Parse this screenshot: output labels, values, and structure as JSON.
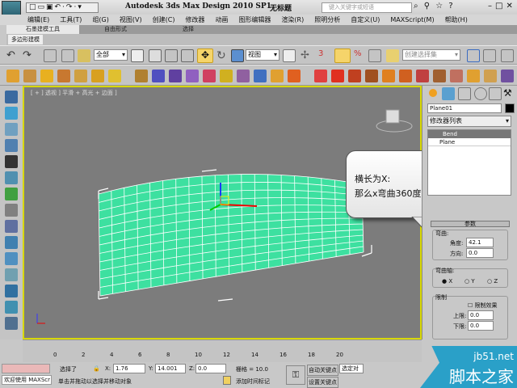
{
  "titlebar": {
    "app_title": "Autodesk 3ds Max Design 2010 SP1",
    "doc_title": "无标题",
    "search_placeholder": "键入关键字或短语",
    "logo": "3DS",
    "quick_access": "□▭▣↶·↷·▾"
  },
  "menu": [
    "编辑(E)",
    "工具(T)",
    "组(G)",
    "视图(V)",
    "创建(C)",
    "修改器",
    "动画",
    "图形编辑器",
    "渲染(R)",
    "照明分析",
    "自定义(U)",
    "MAXScript(M)",
    "帮助(H)"
  ],
  "ribbon_tabs": [
    "石墨建模工具",
    "自由形式",
    "选择"
  ],
  "subtab": "多边形建模",
  "toolbar": {
    "selection_filter": "全部",
    "ref_coord": "视图",
    "named_selection": "创建选择集"
  },
  "viewport": {
    "label": "[ + ] 透视 ] 平滑 + 高光 + 边面 ]"
  },
  "callout": {
    "line1": "横长为X:",
    "line2": "那么x弯曲360度"
  },
  "panel": {
    "object_name": "Plane01",
    "modifier_list": "修改器列表",
    "stack": [
      "Bend",
      "Plane"
    ],
    "rollout": "参数",
    "bend_group": "弯曲:",
    "angle_label": "角度:",
    "angle_value": "42.1",
    "direction_label": "方向:",
    "direction_value": "0.0",
    "axis_group": "弯曲轴:",
    "axes": [
      "X",
      "Y",
      "Z"
    ],
    "selected_axis": "X",
    "limits_group": "限制",
    "limit_effect": "限制效果",
    "upper_label": "上限:",
    "upper_value": "0.0",
    "lower_label": "下限:",
    "lower_value": "0.0"
  },
  "timeline": {
    "ticks": [
      "0",
      "2",
      "4",
      "6",
      "8",
      "10",
      "12",
      "14",
      "16",
      "18",
      "20"
    ]
  },
  "status": {
    "welcome": "欢迎使用 MAXScr",
    "selected": "选择了",
    "x_label": "X:",
    "x": "1.76",
    "y_label": "Y:",
    "y": "14.001",
    "z_label": "Z:",
    "z": "0.0",
    "grid": "栅格 = 10.0",
    "prompt": "单击并拖动以选择并移动对象",
    "add_time_tag": "添加时间标记",
    "auto_key": "自动关键点",
    "set_key": "设置关键点",
    "selected_objects": "选定对"
  },
  "watermark": {
    "site": "jb51.net",
    "name": "脚本之家"
  }
}
